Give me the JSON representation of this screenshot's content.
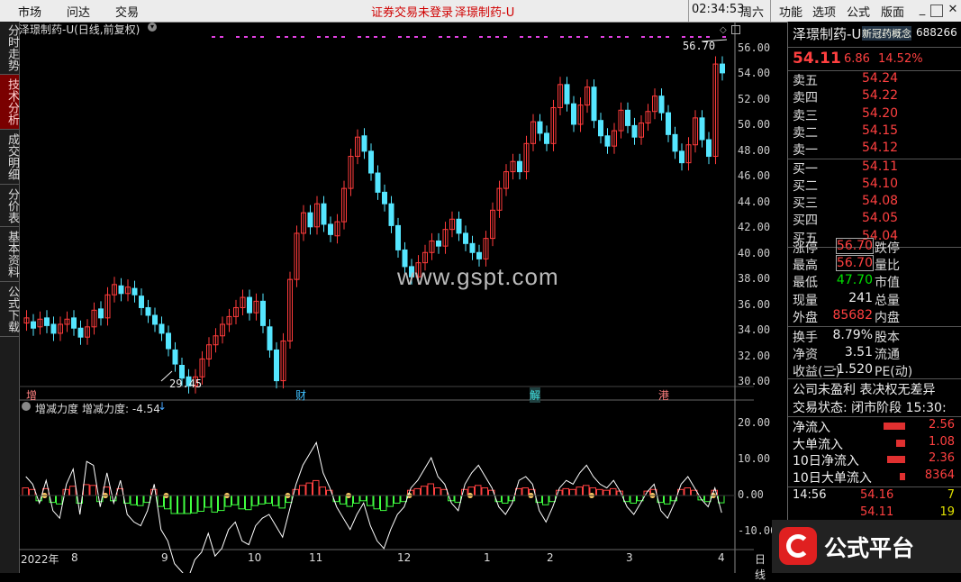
{
  "menu": {
    "items": [
      "市场",
      "问达",
      "交易"
    ],
    "status": [
      "证券交易未登录",
      "泽璟制药-U"
    ],
    "time": "02:34:53",
    "weekday": "周六",
    "right": [
      "功能",
      "选项",
      "公式",
      "版面"
    ]
  },
  "sidebar": [
    "分时走势",
    "技术分析",
    "成交明细",
    "分价表",
    "基本资料",
    "公式下载"
  ],
  "chart": {
    "title": "泽璟制药-U(日线,前复权)",
    "price_ticks": [
      "56.00",
      "54.00",
      "52.00",
      "50.00",
      "48.00",
      "46.00",
      "44.00",
      "42.00",
      "40.00",
      "38.00",
      "36.00",
      "34.00",
      "32.00",
      "30.00"
    ],
    "high_label": "56.70",
    "low_label": "29.45",
    "event_marks": [
      {
        "text": "增"
      },
      {
        "text": "财"
      },
      {
        "text": "解"
      },
      {
        "text": "港"
      }
    ],
    "watermark": "www.gspt.com",
    "indicator_title": "增减力度",
    "indicator_value": "增减力度: -4.54",
    "indicator_ticks": [
      "20.00",
      "10.00",
      "0.00",
      "-10.00"
    ],
    "x_labels": [
      "2022年",
      "8",
      "9",
      "10",
      "11",
      "12",
      "1",
      "2",
      "3",
      "4"
    ],
    "x_suffix": "日线"
  },
  "chart_data": {
    "type": "candlestick",
    "ylim": [
      29,
      57
    ],
    "candles": [
      [
        34.6,
        35
      ],
      [
        34.7,
        34.2
      ],
      [
        34.3,
        34.9
      ],
      [
        35.0,
        34.4
      ],
      [
        34.5,
        33.8
      ],
      [
        33.8,
        34.5
      ],
      [
        34.5,
        34.9
      ],
      [
        35.0,
        34.2
      ],
      [
        34.2,
        33.5
      ],
      [
        33.5,
        34.3
      ],
      [
        34.3,
        35.6
      ],
      [
        35.7,
        35.0
      ],
      [
        35.0,
        36.8
      ],
      [
        36.8,
        37.6
      ],
      [
        37.5,
        36.9
      ],
      [
        36.9,
        37.4
      ],
      [
        37.3,
        36.8
      ],
      [
        36.7,
        35.8
      ],
      [
        35.8,
        35.2
      ],
      [
        35.2,
        34.5
      ],
      [
        34.5,
        33.8
      ],
      [
        33.8,
        32.6
      ],
      [
        32.5,
        31.4
      ],
      [
        31.3,
        30.3
      ],
      [
        30.4,
        29.7
      ],
      [
        29.7,
        30.4
      ],
      [
        30.4,
        31.8
      ],
      [
        31.8,
        32.9
      ],
      [
        32.9,
        33.6
      ],
      [
        33.6,
        34.5
      ],
      [
        34.5,
        35.1
      ],
      [
        35.1,
        35.8
      ],
      [
        35.8,
        36.6
      ],
      [
        36.6,
        35.4
      ],
      [
        35.4,
        36.3
      ],
      [
        36.3,
        34.4
      ],
      [
        34.3,
        32.5
      ],
      [
        32.5,
        30.1
      ],
      [
        30.1,
        33.2
      ],
      [
        33.2,
        38.0
      ],
      [
        38.0,
        41.6
      ],
      [
        41.6,
        43.2
      ],
      [
        43.2,
        42.1
      ],
      [
        42.1,
        43.9
      ],
      [
        43.9,
        42.3
      ],
      [
        42.3,
        41.5
      ],
      [
        41.4,
        42.5
      ],
      [
        42.5,
        45.1
      ],
      [
        45.1,
        47.6
      ],
      [
        47.6,
        49.1
      ],
      [
        49.2,
        48.0
      ],
      [
        48.0,
        46.3
      ],
      [
        46.3,
        44.8
      ],
      [
        44.8,
        43.9
      ],
      [
        43.9,
        42.2
      ],
      [
        42.2,
        40.3
      ],
      [
        40.3,
        39.0
      ],
      [
        39.0,
        38.2
      ],
      [
        38.2,
        39.3
      ],
      [
        39.3,
        40.1
      ],
      [
        40.1,
        41.0
      ],
      [
        41.0,
        40.6
      ],
      [
        40.6,
        41.9
      ],
      [
        41.9,
        42.7
      ],
      [
        42.7,
        41.6
      ],
      [
        41.6,
        40.8
      ],
      [
        40.8,
        40.1
      ],
      [
        40.1,
        39.6
      ],
      [
        39.6,
        41.2
      ],
      [
        41.2,
        43.4
      ],
      [
        43.4,
        45.1
      ],
      [
        45.1,
        46.4
      ],
      [
        46.4,
        47.2
      ],
      [
        47.2,
        46.4
      ],
      [
        46.4,
        48.6
      ],
      [
        48.6,
        50.3
      ],
      [
        50.3,
        49.4
      ],
      [
        49.4,
        48.6
      ],
      [
        48.6,
        51.4
      ],
      [
        51.4,
        53.2
      ],
      [
        53.2,
        51.7
      ],
      [
        51.7,
        50.1
      ],
      [
        50.1,
        51.6
      ],
      [
        51.6,
        53.0
      ],
      [
        53.0,
        50.4
      ],
      [
        50.4,
        49.2
      ],
      [
        49.2,
        48.4
      ],
      [
        48.4,
        49.6
      ],
      [
        49.6,
        51.2
      ],
      [
        51.2,
        50.0
      ],
      [
        50.0,
        49.1
      ],
      [
        49.1,
        50.2
      ],
      [
        50.2,
        51.1
      ],
      [
        51.1,
        52.3
      ],
      [
        52.3,
        51.0
      ],
      [
        51.0,
        49.3
      ],
      [
        49.3,
        48.0
      ],
      [
        48.0,
        47.1
      ],
      [
        47.1,
        48.5
      ],
      [
        48.5,
        50.6
      ],
      [
        50.6,
        48.9
      ],
      [
        48.9,
        47.6
      ],
      [
        47.6,
        54.8
      ],
      [
        54.8,
        54.11
      ]
    ],
    "indicator": [
      5,
      3,
      -2,
      4,
      -4,
      -6,
      3,
      7,
      -5,
      9,
      8,
      -3,
      6,
      -2,
      4,
      -5,
      -7,
      -8,
      -4,
      3,
      -9,
      -12,
      -18,
      -20,
      -22,
      -17,
      -15,
      -10,
      -16,
      -14,
      -9,
      -7,
      -12,
      -13,
      -8,
      -6,
      -5,
      -8,
      -11,
      -4,
      3,
      8,
      11,
      14,
      6,
      2,
      -3,
      -6,
      -9,
      -5,
      -2,
      -8,
      -12,
      -14,
      -9,
      -5,
      -3,
      2,
      4,
      7,
      10,
      5,
      3,
      -2,
      -4,
      3,
      6,
      8,
      5,
      2,
      -3,
      -5,
      -2,
      4,
      5,
      3,
      -4,
      -7,
      -3,
      2,
      4,
      3,
      6,
      8,
      5,
      3,
      2,
      4,
      1,
      -3,
      -5,
      -2,
      1,
      3,
      -4,
      -6,
      -2,
      3,
      5,
      2,
      -1,
      -3,
      2,
      -4.54
    ]
  },
  "panel": {
    "name": "泽璟制药-U",
    "concept": "新冠药概念",
    "code": "688266",
    "price": "54.11",
    "change": "6.86",
    "pct": "14.52%",
    "asks": [
      [
        "卖五",
        "54.24"
      ],
      [
        "卖四",
        "54.22"
      ],
      [
        "卖三",
        "54.20"
      ],
      [
        "卖二",
        "54.15"
      ],
      [
        "卖一",
        "54.12"
      ]
    ],
    "bids": [
      [
        "买一",
        "54.11"
      ],
      [
        "买二",
        "54.10"
      ],
      [
        "买三",
        "54.08"
      ],
      [
        "买四",
        "54.05"
      ],
      [
        "买五",
        "54.04"
      ]
    ],
    "stats": [
      [
        "涨停",
        "56.70",
        "跌停"
      ],
      [
        "最高",
        "56.70",
        "量比"
      ],
      [
        "最低",
        "47.70",
        "市值"
      ],
      [
        "现量",
        "241",
        "总量"
      ],
      [
        "外盘",
        "85682",
        "内盘"
      ]
    ],
    "stats2": [
      [
        "换手",
        "8.79%",
        "股本"
      ],
      [
        "净资",
        "3.51",
        "流通"
      ],
      [
        "收益(三)",
        "-1.520",
        "PE(动)"
      ]
    ],
    "notice": "公司未盈利 表决权无差异",
    "trade_state": "交易状态: 闭市阶段 15:30:",
    "flows": [
      [
        "净流入",
        "2.56"
      ],
      [
        "大单流入",
        "1.08"
      ],
      [
        "10日净流入",
        "2.36"
      ],
      [
        "10日大单流入",
        "8364"
      ]
    ],
    "ticks": [
      [
        "14:56",
        "54.16",
        "7"
      ],
      [
        "",
        "54.11",
        "19"
      ]
    ],
    "logo_text": "公式平台"
  }
}
